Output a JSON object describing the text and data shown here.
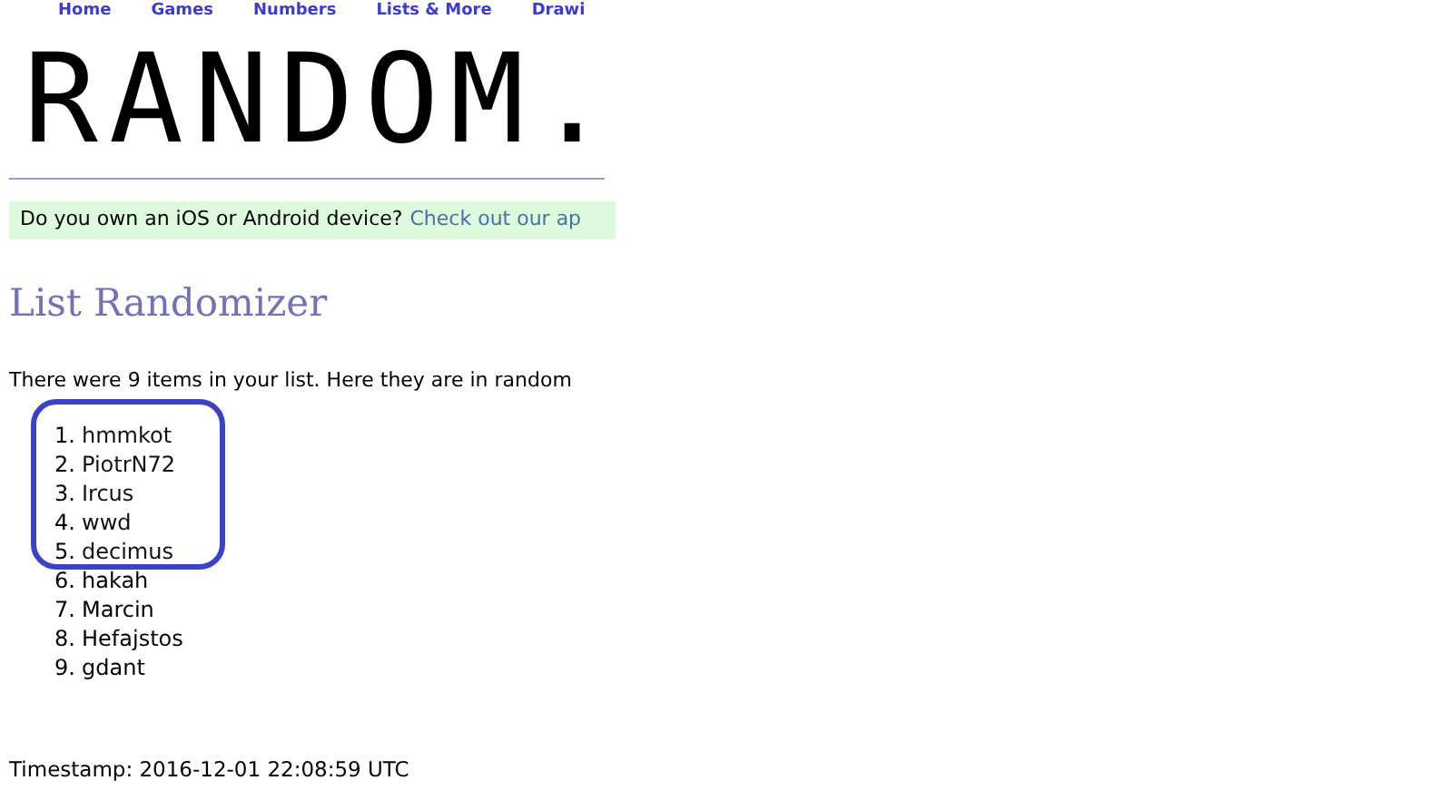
{
  "nav": [
    "Home",
    "Games",
    "Numbers",
    "Lists & More",
    "Drawi"
  ],
  "logo": "RANDOM.",
  "promo": {
    "text": "Do you own an iOS or Android device?",
    "link": "Check out our ap"
  },
  "heading": "List Randomizer",
  "intro": "There were 9 items in your list. Here they are in random",
  "items": [
    {
      "number": "1.",
      "name": "hmmkot",
      "highlighted": true
    },
    {
      "number": "2.",
      "name": "PiotrN72",
      "highlighted": true
    },
    {
      "number": "3.",
      "name": "Ircus",
      "highlighted": true
    },
    {
      "number": "4.",
      "name": "wwd",
      "highlighted": true
    },
    {
      "number": "5.",
      "name": "decimus",
      "highlighted": true
    },
    {
      "number": "6.",
      "name": "hakah",
      "highlighted": false
    },
    {
      "number": "7.",
      "name": "Marcin",
      "highlighted": false
    },
    {
      "number": "8.",
      "name": "Hefajstos",
      "highlighted": false
    },
    {
      "number": "9.",
      "name": "gdant",
      "highlighted": false
    }
  ],
  "timestamp": "Timestamp: 2016-12-01 22:08:59 UTC"
}
